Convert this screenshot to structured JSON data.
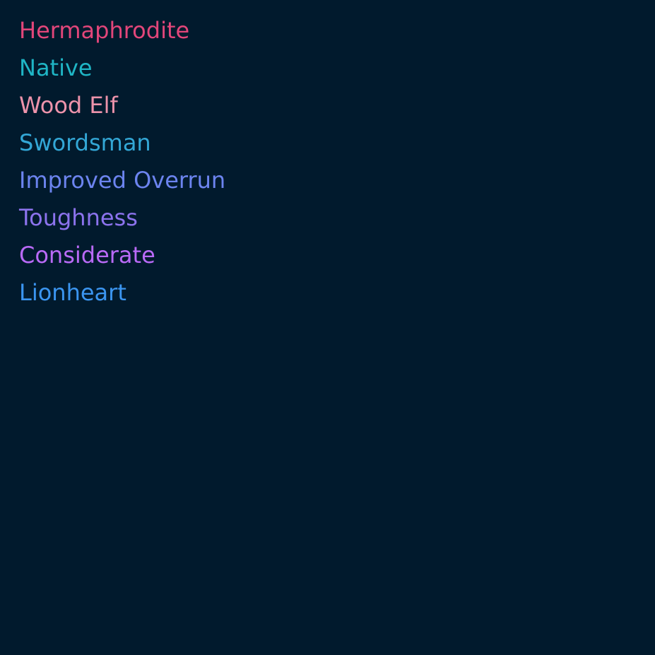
{
  "traits": [
    {
      "label": "Hermaphrodite",
      "color": "#e2467a"
    },
    {
      "label": "Native",
      "color": "#1fb5c5"
    },
    {
      "label": "Wood Elf",
      "color": "#ed93ab"
    },
    {
      "label": "Swordsman",
      "color": "#33a7d6"
    },
    {
      "label": "Improved Overrun",
      "color": "#6c84ef"
    },
    {
      "label": "Toughness",
      "color": "#8c73ed"
    },
    {
      "label": "Considerate",
      "color": "#b96af7"
    },
    {
      "label": "Lionheart",
      "color": "#3b95f0"
    }
  ]
}
